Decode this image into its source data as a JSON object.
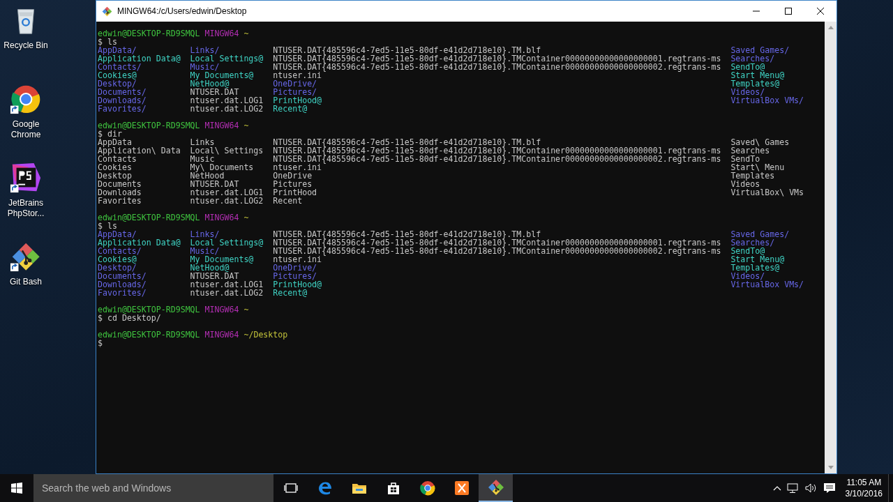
{
  "desktop_icons": [
    {
      "kind": "recycle-bin",
      "label": "Recycle Bin",
      "shortcut": false
    },
    {
      "kind": "chrome",
      "label": "Google Chrome",
      "shortcut": true
    },
    {
      "kind": "phpstorm",
      "label": "JetBrains PhpStor...",
      "shortcut": true
    },
    {
      "kind": "git",
      "label": "Git Bash",
      "shortcut": true
    }
  ],
  "window": {
    "title": "MINGW64:/c/Users/edwin/Desktop"
  },
  "terminal": {
    "blocks": [
      {
        "prompt": {
          "user_host": "edwin@DESKTOP-RD9SMQL",
          "system": "MINGW64",
          "path": "~"
        },
        "symbol": "$",
        "command": "ls",
        "output": [
          [
            {
              "text": "AppData/",
              "kind": "dir"
            },
            {
              "text": "Application Data@",
              "kind": "link"
            },
            {
              "text": "Contacts/",
              "kind": "dir"
            },
            {
              "text": "Cookies@",
              "kind": "link"
            },
            {
              "text": "Desktop/",
              "kind": "dir"
            },
            {
              "text": "Documents/",
              "kind": "dir"
            },
            {
              "text": "Downloads/",
              "kind": "dir"
            },
            {
              "text": "Favorites/",
              "kind": "dir"
            }
          ],
          [
            {
              "text": "Links/",
              "kind": "dir"
            },
            {
              "text": "Local Settings@",
              "kind": "link"
            },
            {
              "text": "Music/",
              "kind": "dir"
            },
            {
              "text": "My Documents@",
              "kind": "link"
            },
            {
              "text": "NetHood@",
              "kind": "link"
            },
            {
              "text": "NTUSER.DAT",
              "kind": "file"
            },
            {
              "text": "ntuser.dat.LOG1",
              "kind": "file"
            },
            {
              "text": "ntuser.dat.LOG2",
              "kind": "file"
            }
          ],
          [
            {
              "text": "NTUSER.DAT{485596c4-7ed5-11e5-80df-e41d2d718e10}.TM.blf",
              "kind": "file"
            },
            {
              "text": "NTUSER.DAT{485596c4-7ed5-11e5-80df-e41d2d718e10}.TMContainer00000000000000000001.regtrans-ms",
              "kind": "file"
            },
            {
              "text": "NTUSER.DAT{485596c4-7ed5-11e5-80df-e41d2d718e10}.TMContainer00000000000000000002.regtrans-ms",
              "kind": "file"
            },
            {
              "text": "ntuser.ini",
              "kind": "file"
            },
            {
              "text": "OneDrive/",
              "kind": "dir"
            },
            {
              "text": "Pictures/",
              "kind": "dir"
            },
            {
              "text": "PrintHood@",
              "kind": "link"
            },
            {
              "text": "Recent@",
              "kind": "link"
            }
          ],
          [
            {
              "text": "Saved Games/",
              "kind": "dir"
            },
            {
              "text": "Searches/",
              "kind": "dir"
            },
            {
              "text": "SendTo@",
              "kind": "link"
            },
            {
              "text": "Start Menu@",
              "kind": "link"
            },
            {
              "text": "Templates@",
              "kind": "link"
            },
            {
              "text": "Videos/",
              "kind": "dir"
            },
            {
              "text": "VirtualBox VMs/",
              "kind": "dir"
            }
          ]
        ]
      },
      {
        "prompt": {
          "user_host": "edwin@DESKTOP-RD9SMQL",
          "system": "MINGW64",
          "path": "~"
        },
        "symbol": "$",
        "command": "dir",
        "output": [
          [
            {
              "text": "AppData",
              "kind": "file"
            },
            {
              "text": "Application\\ Data",
              "kind": "file"
            },
            {
              "text": "Contacts",
              "kind": "file"
            },
            {
              "text": "Cookies",
              "kind": "file"
            },
            {
              "text": "Desktop",
              "kind": "file"
            },
            {
              "text": "Documents",
              "kind": "file"
            },
            {
              "text": "Downloads",
              "kind": "file"
            },
            {
              "text": "Favorites",
              "kind": "file"
            }
          ],
          [
            {
              "text": "Links",
              "kind": "file"
            },
            {
              "text": "Local\\ Settings",
              "kind": "file"
            },
            {
              "text": "Music",
              "kind": "file"
            },
            {
              "text": "My\\ Documents",
              "kind": "file"
            },
            {
              "text": "NetHood",
              "kind": "file"
            },
            {
              "text": "NTUSER.DAT",
              "kind": "file"
            },
            {
              "text": "ntuser.dat.LOG1",
              "kind": "file"
            },
            {
              "text": "ntuser.dat.LOG2",
              "kind": "file"
            }
          ],
          [
            {
              "text": "NTUSER.DAT{485596c4-7ed5-11e5-80df-e41d2d718e10}.TM.blf",
              "kind": "file"
            },
            {
              "text": "NTUSER.DAT{485596c4-7ed5-11e5-80df-e41d2d718e10}.TMContainer00000000000000000001.regtrans-ms",
              "kind": "file"
            },
            {
              "text": "NTUSER.DAT{485596c4-7ed5-11e5-80df-e41d2d718e10}.TMContainer00000000000000000002.regtrans-ms",
              "kind": "file"
            },
            {
              "text": "ntuser.ini",
              "kind": "file"
            },
            {
              "text": "OneDrive",
              "kind": "file"
            },
            {
              "text": "Pictures",
              "kind": "file"
            },
            {
              "text": "PrintHood",
              "kind": "file"
            },
            {
              "text": "Recent",
              "kind": "file"
            }
          ],
          [
            {
              "text": "Saved\\ Games",
              "kind": "file"
            },
            {
              "text": "Searches",
              "kind": "file"
            },
            {
              "text": "SendTo",
              "kind": "file"
            },
            {
              "text": "Start\\ Menu",
              "kind": "file"
            },
            {
              "text": "Templates",
              "kind": "file"
            },
            {
              "text": "Videos",
              "kind": "file"
            },
            {
              "text": "VirtualBox\\ VMs",
              "kind": "file"
            }
          ]
        ]
      },
      {
        "prompt": {
          "user_host": "edwin@DESKTOP-RD9SMQL",
          "system": "MINGW64",
          "path": "~"
        },
        "symbol": "$",
        "command": "ls",
        "output": [
          [
            {
              "text": "AppData/",
              "kind": "dir"
            },
            {
              "text": "Application Data@",
              "kind": "link"
            },
            {
              "text": "Contacts/",
              "kind": "dir"
            },
            {
              "text": "Cookies@",
              "kind": "link"
            },
            {
              "text": "Desktop/",
              "kind": "dir"
            },
            {
              "text": "Documents/",
              "kind": "dir"
            },
            {
              "text": "Downloads/",
              "kind": "dir"
            },
            {
              "text": "Favorites/",
              "kind": "dir"
            }
          ],
          [
            {
              "text": "Links/",
              "kind": "dir"
            },
            {
              "text": "Local Settings@",
              "kind": "link"
            },
            {
              "text": "Music/",
              "kind": "dir"
            },
            {
              "text": "My Documents@",
              "kind": "link"
            },
            {
              "text": "NetHood@",
              "kind": "link"
            },
            {
              "text": "NTUSER.DAT",
              "kind": "file"
            },
            {
              "text": "ntuser.dat.LOG1",
              "kind": "file"
            },
            {
              "text": "ntuser.dat.LOG2",
              "kind": "file"
            }
          ],
          [
            {
              "text": "NTUSER.DAT{485596c4-7ed5-11e5-80df-e41d2d718e10}.TM.blf",
              "kind": "file"
            },
            {
              "text": "NTUSER.DAT{485596c4-7ed5-11e5-80df-e41d2d718e10}.TMContainer00000000000000000001.regtrans-ms",
              "kind": "file"
            },
            {
              "text": "NTUSER.DAT{485596c4-7ed5-11e5-80df-e41d2d718e10}.TMContainer00000000000000000002.regtrans-ms",
              "kind": "file"
            },
            {
              "text": "ntuser.ini",
              "kind": "file"
            },
            {
              "text": "OneDrive/",
              "kind": "dir"
            },
            {
              "text": "Pictures/",
              "kind": "dir"
            },
            {
              "text": "PrintHood@",
              "kind": "link"
            },
            {
              "text": "Recent@",
              "kind": "link"
            }
          ],
          [
            {
              "text": "Saved Games/",
              "kind": "dir"
            },
            {
              "text": "Searches/",
              "kind": "dir"
            },
            {
              "text": "SendTo@",
              "kind": "link"
            },
            {
              "text": "Start Menu@",
              "kind": "link"
            },
            {
              "text": "Templates@",
              "kind": "link"
            },
            {
              "text": "Videos/",
              "kind": "dir"
            },
            {
              "text": "VirtualBox VMs/",
              "kind": "dir"
            }
          ]
        ]
      },
      {
        "prompt": {
          "user_host": "edwin@DESKTOP-RD9SMQL",
          "system": "MINGW64",
          "path": "~"
        },
        "symbol": "$",
        "command": "cd Desktop/"
      },
      {
        "prompt": {
          "user_host": "edwin@DESKTOP-RD9SMQL",
          "system": "MINGW64",
          "path": "~/Desktop"
        },
        "symbol": "$"
      }
    ]
  },
  "taskbar": {
    "search": {
      "placeholder": "Search the web and Windows"
    },
    "apps": [
      {
        "kind": "task-view",
        "active": false
      },
      {
        "kind": "edge",
        "active": false
      },
      {
        "kind": "explorer",
        "active": false
      },
      {
        "kind": "store",
        "active": false
      },
      {
        "kind": "chrome",
        "active": false
      },
      {
        "kind": "xampp",
        "active": false
      },
      {
        "kind": "git",
        "active": true
      }
    ],
    "clock": {
      "time": "11:05 AM",
      "date": "3/10/2016"
    }
  }
}
